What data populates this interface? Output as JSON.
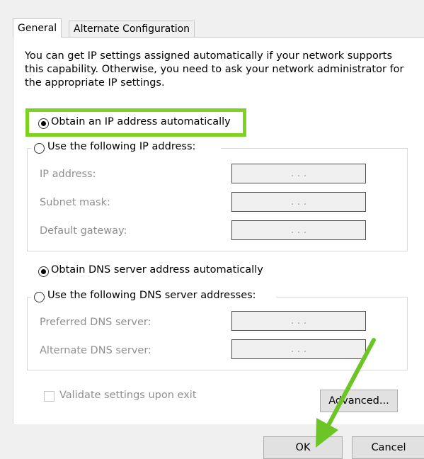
{
  "tabs": [
    {
      "label": "General"
    },
    {
      "label": "Alternate Configuration"
    }
  ],
  "intro_text": "You can get IP settings assigned automatically if your network supports this capability. Otherwise, you need to ask your network administrator for the appropriate IP settings.",
  "ip": {
    "auto_label": "Obtain an IP address automatically",
    "manual_label": "Use the following IP address:",
    "selected": "auto",
    "fields": [
      {
        "label": "IP address:",
        "value": ".   .   ."
      },
      {
        "label": "Subnet mask:",
        "value": ".   .   ."
      },
      {
        "label": "Default gateway:",
        "value": ".   .   ."
      }
    ]
  },
  "dns": {
    "auto_label": "Obtain DNS server address automatically",
    "manual_label": "Use the following DNS server addresses:",
    "selected": "auto",
    "fields": [
      {
        "label": "Preferred DNS server:",
        "value": ".   .   ."
      },
      {
        "label": "Alternate DNS server:",
        "value": ".   .   ."
      }
    ]
  },
  "validate_label": "Validate settings upon exit",
  "validate_checked": false,
  "buttons": {
    "advanced": "Advanced...",
    "ok": "OK",
    "cancel": "Cancel"
  },
  "colors": {
    "highlight": "#7ed320",
    "arrow": "#6cc524"
  }
}
